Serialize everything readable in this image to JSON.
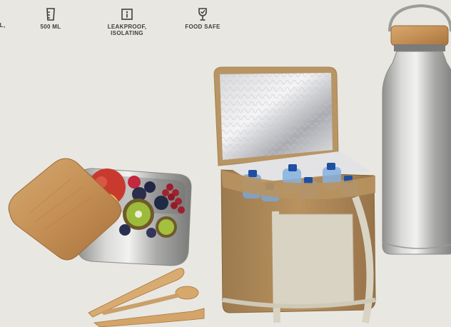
{
  "features": [
    {
      "label": "EL,",
      "icon": "none"
    },
    {
      "label": "500 ML",
      "icon": "measuring-cup-icon"
    },
    {
      "label": "LEAKPROOF,\nISOLATING",
      "icon": "info-box-icon"
    },
    {
      "label": "FOOD SAFE",
      "icon": "wine-glass-icon"
    }
  ],
  "colors": {
    "background": "#e9e7e1",
    "text": "#3e3e3c",
    "bamboo": "#c89a63",
    "jute": "#b08a5a",
    "steel": "#b9b9b7"
  }
}
